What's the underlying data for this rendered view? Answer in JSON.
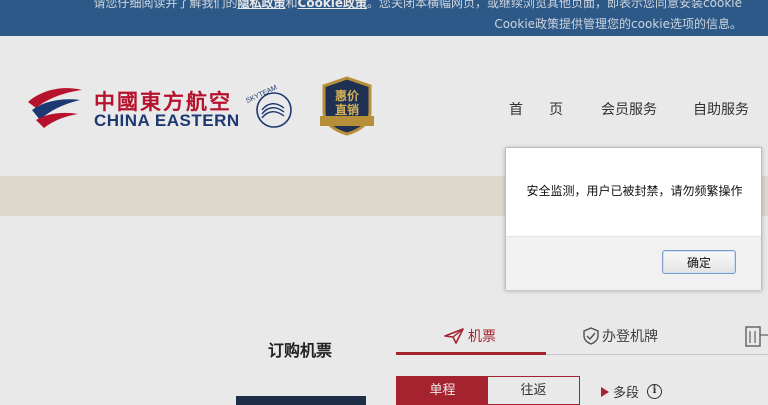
{
  "cookie_banner": {
    "line1_pre": "请您仔细阅读并了解我们的",
    "privacy_link": "隐私政策",
    "and": "和",
    "cookie_link": "Cookie政策",
    "line1_post": "。您关闭本横幅网页，或继续浏览其他页面，即表示您同意安装cookie",
    "line2": "Cookie政策提供管理您的cookie选项的信息。"
  },
  "header": {
    "logo_cn": "中國東方航空",
    "logo_en": "CHINA EASTERN",
    "skyteam_text": "SKYTEAM",
    "badge_line1": "惠价",
    "badge_line2": "直销",
    "nav": {
      "home": "首页",
      "member": "会员服务",
      "self_service": "自助服务"
    }
  },
  "booking": {
    "title": "订购机票",
    "tabs": {
      "flight": "机票",
      "checkin": "办登机牌"
    },
    "trip_types": {
      "one_way": "单程",
      "round_trip": "往返",
      "multi": "多段"
    },
    "info": "i"
  },
  "dialog": {
    "message": "安全监测，用户已被封禁，请勿频繁操作",
    "ok_label": "确定"
  },
  "colors": {
    "brand_red": "#b4232f",
    "brand_blue": "#1b3b7a",
    "banner_blue": "#2e5f93"
  }
}
